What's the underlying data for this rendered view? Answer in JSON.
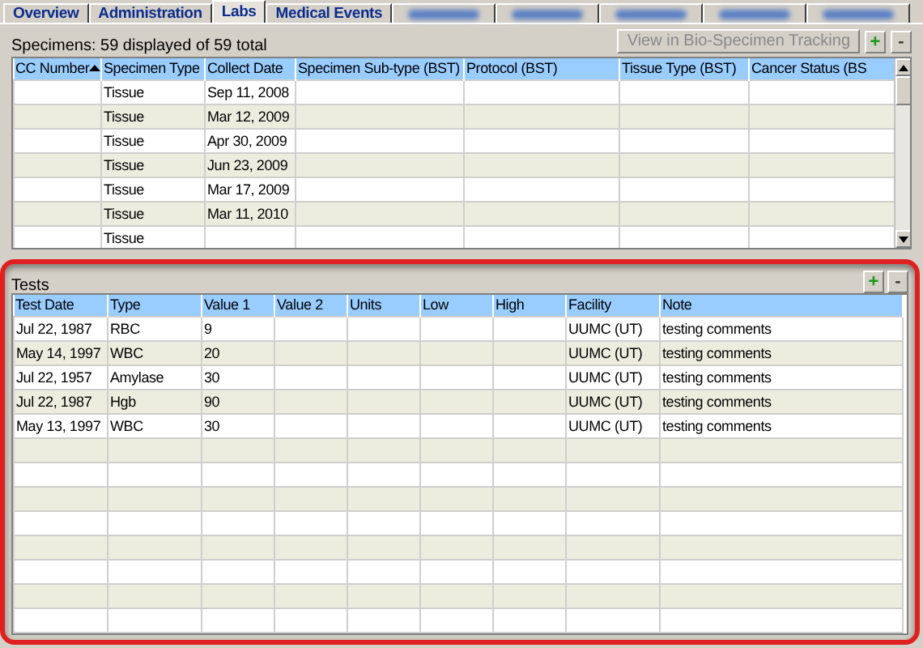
{
  "tabs": [
    {
      "kind": "text",
      "label": "Overview",
      "selected": false
    },
    {
      "kind": "text",
      "label": "Administration",
      "selected": false
    },
    {
      "kind": "text",
      "label": "Labs",
      "selected": true
    },
    {
      "kind": "text",
      "label": "Medical Events",
      "selected": false
    },
    {
      "kind": "redacted",
      "selected": false
    },
    {
      "kind": "redacted",
      "selected": false
    },
    {
      "kind": "redacted",
      "selected": false
    },
    {
      "kind": "redacted",
      "selected": false
    },
    {
      "kind": "redacted",
      "selected": false
    }
  ],
  "specimens": {
    "summary": "Specimens: 59 displayed of 59 total",
    "tracking_button": {
      "label": "View in Bio-Specimen Tracking",
      "disabled": true
    },
    "add_button": "+",
    "remove_button": "-",
    "columns": [
      {
        "label": "CC Number",
        "sort_ascending": true
      },
      {
        "label": "Specimen Type"
      },
      {
        "label": "Collect Date"
      },
      {
        "label": "Specimen Sub-type (BST)"
      },
      {
        "label": "Protocol (BST)"
      },
      {
        "label": "Tissue Type (BST)"
      },
      {
        "label": "Cancer Status (BS"
      }
    ],
    "rows": [
      [
        null,
        "Tissue",
        "Sep 11, 2008",
        null,
        null,
        null,
        null
      ],
      [
        null,
        "Tissue",
        "Mar 12, 2009",
        null,
        null,
        null,
        null
      ],
      [
        null,
        "Tissue",
        "Apr 30, 2009",
        null,
        null,
        null,
        null
      ],
      [
        null,
        "Tissue",
        "Jun 23, 2009",
        null,
        null,
        null,
        null
      ],
      [
        null,
        "Tissue",
        "Mar 17, 2009",
        null,
        null,
        null,
        null
      ],
      [
        null,
        "Tissue",
        "Mar 11, 2010",
        null,
        null,
        null,
        null
      ],
      [
        null,
        "Tissue",
        null,
        null,
        null,
        null,
        null
      ]
    ]
  },
  "tests": {
    "title": "Tests",
    "add_button": "+",
    "remove_button": "-",
    "columns": [
      {
        "label": "Test Date"
      },
      {
        "label": "Type"
      },
      {
        "label": "Value 1"
      },
      {
        "label": "Value 2"
      },
      {
        "label": "Units"
      },
      {
        "label": "Low"
      },
      {
        "label": "High"
      },
      {
        "label": "Facility"
      },
      {
        "label": "Note"
      }
    ],
    "rows": [
      [
        "Jul 22, 1987",
        "RBC",
        "9",
        null,
        null,
        null,
        null,
        "UUMC (UT)",
        "testing comments"
      ],
      [
        "May 14, 1997",
        "WBC",
        "20",
        null,
        null,
        null,
        null,
        "UUMC (UT)",
        "testing comments"
      ],
      [
        "Jul 22, 1957",
        "Amylase",
        "30",
        null,
        null,
        null,
        null,
        "UUMC (UT)",
        "testing comments"
      ],
      [
        "Jul 22, 1987",
        "Hgb",
        "90",
        null,
        null,
        null,
        null,
        "UUMC (UT)",
        "testing comments"
      ],
      [
        "May 13, 1997",
        "WBC",
        "30",
        null,
        null,
        null,
        null,
        "UUMC (UT)",
        "testing comments"
      ]
    ]
  }
}
